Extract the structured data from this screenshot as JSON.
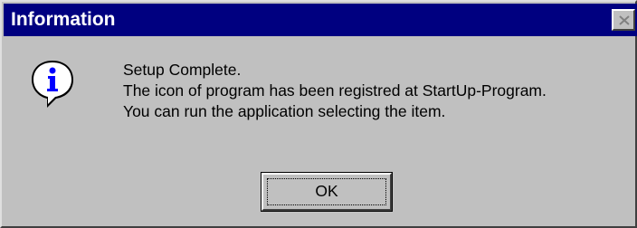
{
  "window": {
    "title": "Information"
  },
  "icons": {
    "info": "information-icon",
    "close": "close-icon"
  },
  "colors": {
    "titlebar": "#000080",
    "face": "#c0c0c0",
    "icon_blue": "#0000ff"
  },
  "message": {
    "lines": [
      "Setup Complete.",
      "The icon of program has been registred at StartUp-Program.",
      "You can run the application selecting the item."
    ]
  },
  "buttons": {
    "ok_label": "OK"
  }
}
